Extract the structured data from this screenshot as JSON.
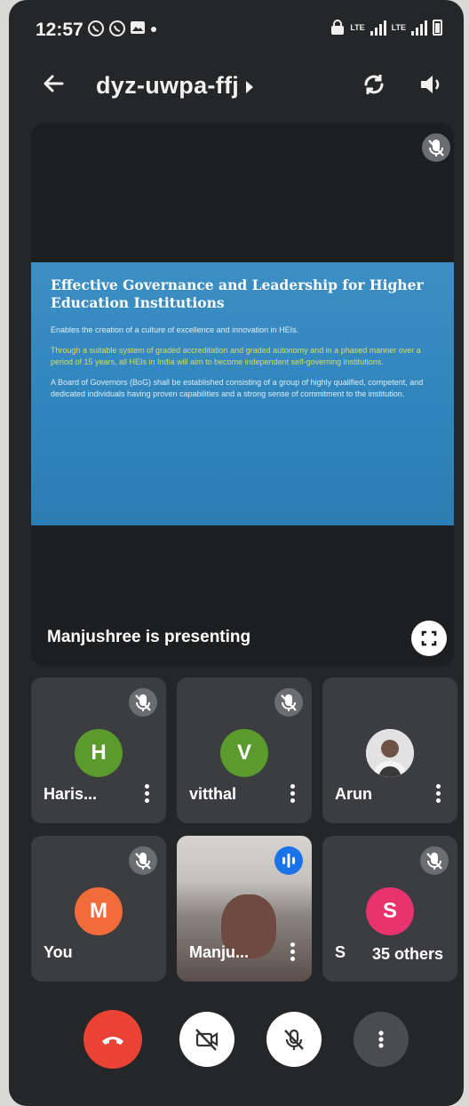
{
  "status_bar": {
    "time": "12:57",
    "network_label": "LTE"
  },
  "header": {
    "meeting_code": "dyz-uwpa-ffj"
  },
  "presentation": {
    "slide": {
      "title": "Effective Governance and Leadership for Higher Education Institutions",
      "paragraphs": [
        "Enables the creation of a culture of excellence and innovation in HEIs.",
        "Through a suitable system of graded accreditation and graded autonomy and in a phased manner over a period of 15 years, all HEIs in India will aim to become independent self-governing institutions.",
        "A Board of Governors (BoG) shall be established consisting of a group of highly qualified, competent, and dedicated individuals having proven capabilities and a strong sense of commitment to the institution."
      ]
    },
    "presenting_label": "Manjushree is presenting"
  },
  "participants": [
    {
      "name": "Haris...",
      "initial": "H",
      "avatar_color": "#5b9a2c",
      "muted": true
    },
    {
      "name": "vitthal",
      "initial": "V",
      "avatar_color": "#5b9a2c",
      "muted": true
    },
    {
      "name": "Arun",
      "initial": "",
      "avatar_color": "#cfcfcf",
      "muted": false
    },
    {
      "name": "You",
      "initial": "M",
      "avatar_color": "#f26b3a",
      "muted": true
    },
    {
      "name": "Manju...",
      "initial": "",
      "avatar_color": "",
      "muted": false,
      "speaking": true
    },
    {
      "name": "S",
      "initial": "S",
      "avatar_color": "#e8336f",
      "muted": true,
      "others_label": "35 others"
    }
  ],
  "colors": {
    "end_call": "#ea4335",
    "speaking": "#1a73e8",
    "background": "#242628"
  }
}
